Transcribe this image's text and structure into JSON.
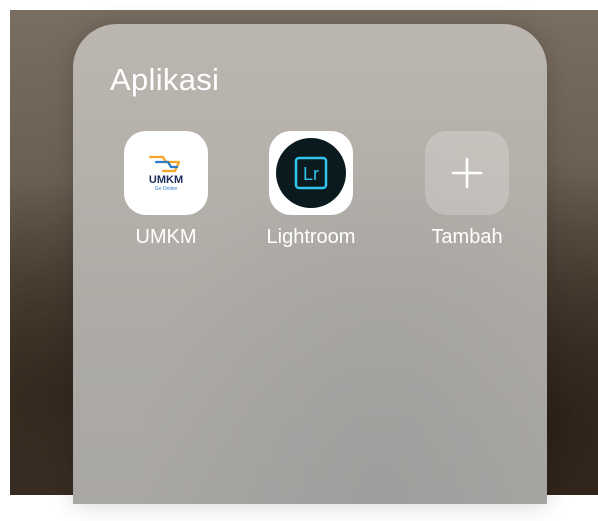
{
  "folder": {
    "title": "Aplikasi",
    "apps": [
      {
        "label": "UMKM",
        "icon": "umkm-go-online-logo",
        "logo_text": "UMKM",
        "logo_subtext": "Go Online"
      },
      {
        "label": "Lightroom",
        "icon": "lightroom-logo",
        "logo_text": "Lr"
      },
      {
        "label": "Tambah",
        "icon": "plus-icon"
      }
    ]
  },
  "colors": {
    "lightroom_bg": "#0b1a1e",
    "lightroom_accent": "#31c5f0",
    "umkm_navy": "#1b2c5c",
    "umkm_orange": "#f5a623",
    "umkm_blue": "#2b7cc4"
  }
}
